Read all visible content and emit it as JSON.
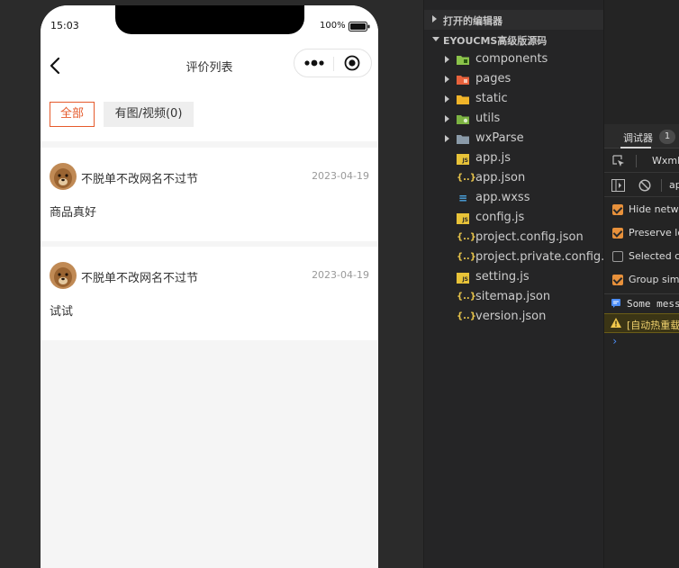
{
  "phone": {
    "status": {
      "time": "15:03",
      "battery": "100%"
    },
    "nav": {
      "title": "评价列表"
    },
    "tabs": [
      {
        "label": "全部"
      },
      {
        "label": "有图/视频(0)"
      }
    ],
    "reviews": [
      {
        "name": "不脱单不改网名不过节",
        "date": "2023-04-19",
        "text": "商品真好"
      },
      {
        "name": "不脱单不改网名不过节",
        "date": "2023-04-19",
        "text": "试试"
      }
    ]
  },
  "explorer": {
    "open_editors": "打开的编辑器",
    "project": "EYOUCMS高级版源码",
    "folders": [
      {
        "name": "components",
        "icon": "folder-components-icon",
        "color": "#8bc34a"
      },
      {
        "name": "pages",
        "icon": "folder-pages-icon",
        "color": "#e8623c"
      },
      {
        "name": "static",
        "icon": "folder-static-icon",
        "color": "#f0b429"
      },
      {
        "name": "utils",
        "icon": "folder-utils-icon",
        "color": "#7cb342"
      },
      {
        "name": "wxParse",
        "icon": "folder-icon",
        "color": "#8a9aa8"
      }
    ],
    "files": [
      {
        "name": "app.js",
        "type": "js"
      },
      {
        "name": "app.json",
        "type": "json"
      },
      {
        "name": "app.wxss",
        "type": "css"
      },
      {
        "name": "config.js",
        "type": "js"
      },
      {
        "name": "project.config.json",
        "type": "json"
      },
      {
        "name": "project.private.config.js...",
        "type": "json"
      },
      {
        "name": "setting.js",
        "type": "js"
      },
      {
        "name": "sitemap.json",
        "type": "json"
      },
      {
        "name": "version.json",
        "type": "json"
      }
    ]
  },
  "debugger": {
    "title": "调试器",
    "badge": "1",
    "tab": "Wxml",
    "context": "ap",
    "options": [
      {
        "label": "Hide netwo",
        "checked": true
      },
      {
        "label": "Preserve lo",
        "checked": true
      },
      {
        "label": "Selected co",
        "checked": false
      },
      {
        "label": "Group simi",
        "checked": true
      }
    ],
    "console": [
      {
        "text": "Some mess",
        "level": "info"
      },
      {
        "text": "[自动热重载",
        "level": "warning"
      }
    ],
    "prompt": "›"
  },
  "colors": {
    "accent": "#e55a2b",
    "warning_bg": "#3b3515",
    "checkbox": "#e8913b"
  }
}
